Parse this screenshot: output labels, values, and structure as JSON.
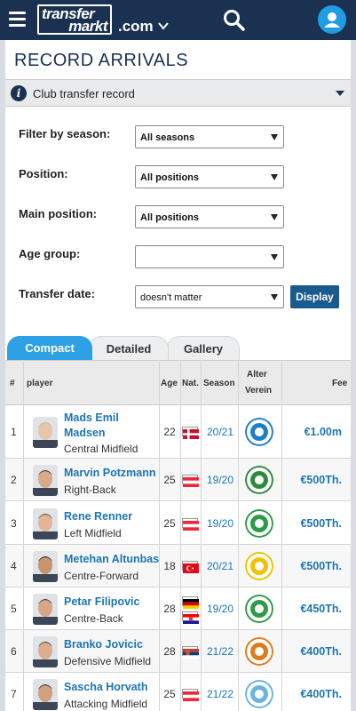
{
  "header": {
    "logo_line1": "transfer",
    "logo_line2": "markt",
    "domain": ".com"
  },
  "page_title": "RECORD ARRIVALS",
  "info_bar": {
    "text": "Club transfer record"
  },
  "filters": {
    "season_label": "Filter by season:",
    "season_value": "All seasons",
    "position_label": "Position:",
    "position_value": "All positions",
    "main_position_label": "Main position:",
    "main_position_value": "All positions",
    "age_group_label": "Age group:",
    "age_group_value": "",
    "transfer_date_label": "Transfer date:",
    "transfer_date_value": "doesn't matter",
    "display_button": "Display"
  },
  "tabs": {
    "compact": "Compact",
    "detailed": "Detailed",
    "gallery": "Gallery"
  },
  "table": {
    "headers": {
      "num": "#",
      "player": "player",
      "age": "Age",
      "nat": "Nat.",
      "season": "Season",
      "old_club_1": "Alter",
      "old_club_2": "Verein",
      "fee": "Fee"
    },
    "rows": [
      {
        "num": "1",
        "name_1": "Mads Emil",
        "name_2": "Madsen",
        "position": "Central Midfield",
        "age": "22",
        "season": "20/21",
        "fee": "€1.00m",
        "nationality": "denmark",
        "club_color": "#1e7fc9"
      },
      {
        "num": "2",
        "name_1": "Marvin Potzmann",
        "name_2": "",
        "position": "Right-Back",
        "age": "25",
        "season": "19/20",
        "fee": "€500Th.",
        "nationality": "austria",
        "club_color": "#2e8b3e"
      },
      {
        "num": "3",
        "name_1": "Rene Renner",
        "name_2": "",
        "position": "Left Midfield",
        "age": "25",
        "season": "19/20",
        "fee": "€500Th.",
        "nationality": "austria",
        "club_color": "#2f9a47"
      },
      {
        "num": "4",
        "name_1": "Metehan Altunbas",
        "name_2": "",
        "position": "Centre-Forward",
        "age": "18",
        "season": "20/21",
        "fee": "€500Th.",
        "nationality": "turkey",
        "club_color": "#f2c200"
      },
      {
        "num": "5",
        "name_1": "Petar Filipovic",
        "name_2": "",
        "position": "Centre-Back",
        "age": "28",
        "season": "19/20",
        "fee": "€450Th.",
        "nationality": "germany+croatia",
        "club_color": "#2f9a47"
      },
      {
        "num": "6",
        "name_1": "Branko Jovicic",
        "name_2": "",
        "position": "Defensive Midfield",
        "age": "28",
        "season": "21/22",
        "fee": "€400Th.",
        "nationality": "serbia",
        "club_color": "#e07b1a"
      },
      {
        "num": "7",
        "name_1": "Sascha Horvath",
        "name_2": "",
        "position": "Attacking Midfield",
        "age": "25",
        "season": "21/22",
        "fee": "€400Th.",
        "nationality": "austria",
        "club_color": "#6ab3e3"
      }
    ]
  }
}
